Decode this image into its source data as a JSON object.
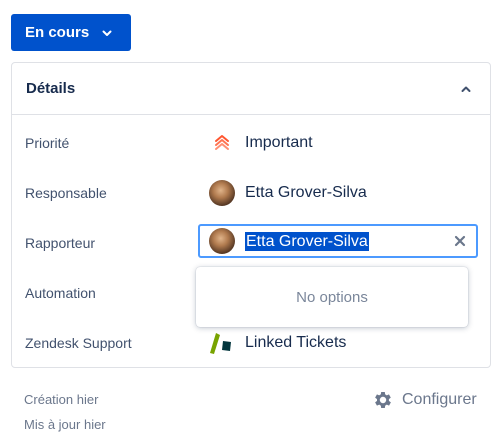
{
  "status_button": {
    "label": "En cours"
  },
  "details": {
    "title": "Détails",
    "fields": [
      {
        "label": "Priorité",
        "value": "Important",
        "icon": "priority-major-icon"
      },
      {
        "label": "Responsable",
        "value": "Etta Grover-Silva",
        "icon": "avatar"
      },
      {
        "label": "Rapporteur",
        "value": "Etta Grover-Silva",
        "icon": "avatar",
        "editing": true
      },
      {
        "label": "Automation",
        "value": "",
        "icon": ""
      },
      {
        "label": "Zendesk Support",
        "value": "Linked Tickets",
        "icon": "zendesk-icon"
      }
    ]
  },
  "dropdown": {
    "empty_text": "No options"
  },
  "footer": {
    "created": "Création hier",
    "updated": "Mis à jour hier",
    "configure_label": "Configurer"
  },
  "colors": {
    "primary": "#0052cc",
    "focus": "#4c9aff",
    "priority": "#ff5630",
    "zendesk_green": "#78a300",
    "zendesk_dark": "#03363d"
  }
}
